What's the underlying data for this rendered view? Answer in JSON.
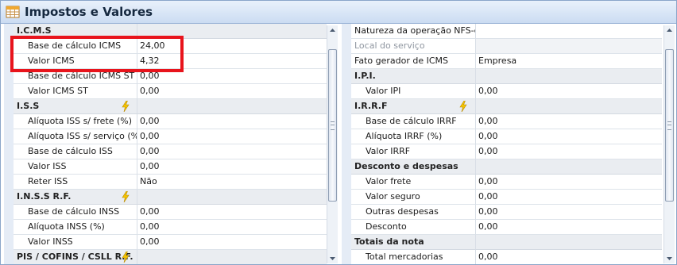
{
  "window": {
    "title": "Impostos e Valores",
    "title_icon": "table-icon"
  },
  "colors": {
    "highlight_box": "#e8141c",
    "category_bg": "#eaedf1",
    "gutter_bg": "#e5ecf6"
  },
  "left": {
    "icms": {
      "label": "I.C.M.S",
      "base_calc_label": "Base de cálculo ICMS",
      "base_calc_value": "24,00",
      "valor_label": "Valor ICMS",
      "valor_value": "4,32",
      "base_st_label": "Base de cálculo ICMS ST",
      "base_st_value": "0,00",
      "valor_st_label": "Valor ICMS ST",
      "valor_st_value": "0,00"
    },
    "iss": {
      "label": "I.S.S",
      "icon": "lightning-icon",
      "aliq_frete_label": "Alíquota ISS s/ frete (%)",
      "aliq_frete_value": "0,00",
      "aliq_serv_label": "Alíquota ISS s/ serviço (%)",
      "aliq_serv_value": "0,00",
      "base_label": "Base de cálculo ISS",
      "base_value": "0,00",
      "valor_label": "Valor ISS",
      "valor_value": "0,00",
      "reter_label": "Reter ISS",
      "reter_value": "Não"
    },
    "inss": {
      "label": "I.N.S.S R.F.",
      "icon": "lightning-icon",
      "base_label": "Base de cálculo INSS",
      "base_value": "0,00",
      "aliq_label": "Alíquota INSS (%)",
      "aliq_value": "0,00",
      "valor_label": "Valor INSS",
      "valor_value": "0,00"
    },
    "pis": {
      "label": "PIS / COFINS / CSLL R.F.",
      "icon": "lightning-icon"
    }
  },
  "right": {
    "natureza_label": "Natureza da operação NFS-e",
    "natureza_value": "",
    "local_label": "Local do serviço",
    "local_value": "",
    "fato_label": "Fato gerador de ICMS",
    "fato_value": "Empresa",
    "ipi": {
      "label": "I.P.I.",
      "valor_label": "Valor IPI",
      "valor_value": "0,00"
    },
    "irrf": {
      "label": "I.R.R.F",
      "icon": "lightning-icon",
      "base_label": "Base de cálculo IRRF",
      "base_value": "0,00",
      "aliq_label": "Alíquota IRRF (%)",
      "aliq_value": "0,00",
      "valor_label": "Valor IRRF",
      "valor_value": "0,00"
    },
    "desconto": {
      "label": "Desconto e despesas",
      "frete_label": "Valor frete",
      "frete_value": "0,00",
      "seguro_label": "Valor seguro",
      "seguro_value": "0,00",
      "outras_label": "Outras despesas",
      "outras_value": "0,00",
      "desconto_label": "Desconto",
      "desconto_value": "0,00"
    },
    "totais": {
      "label": "Totais da nota",
      "merc_label": "Total mercadorias",
      "merc_value": "0,00"
    }
  }
}
